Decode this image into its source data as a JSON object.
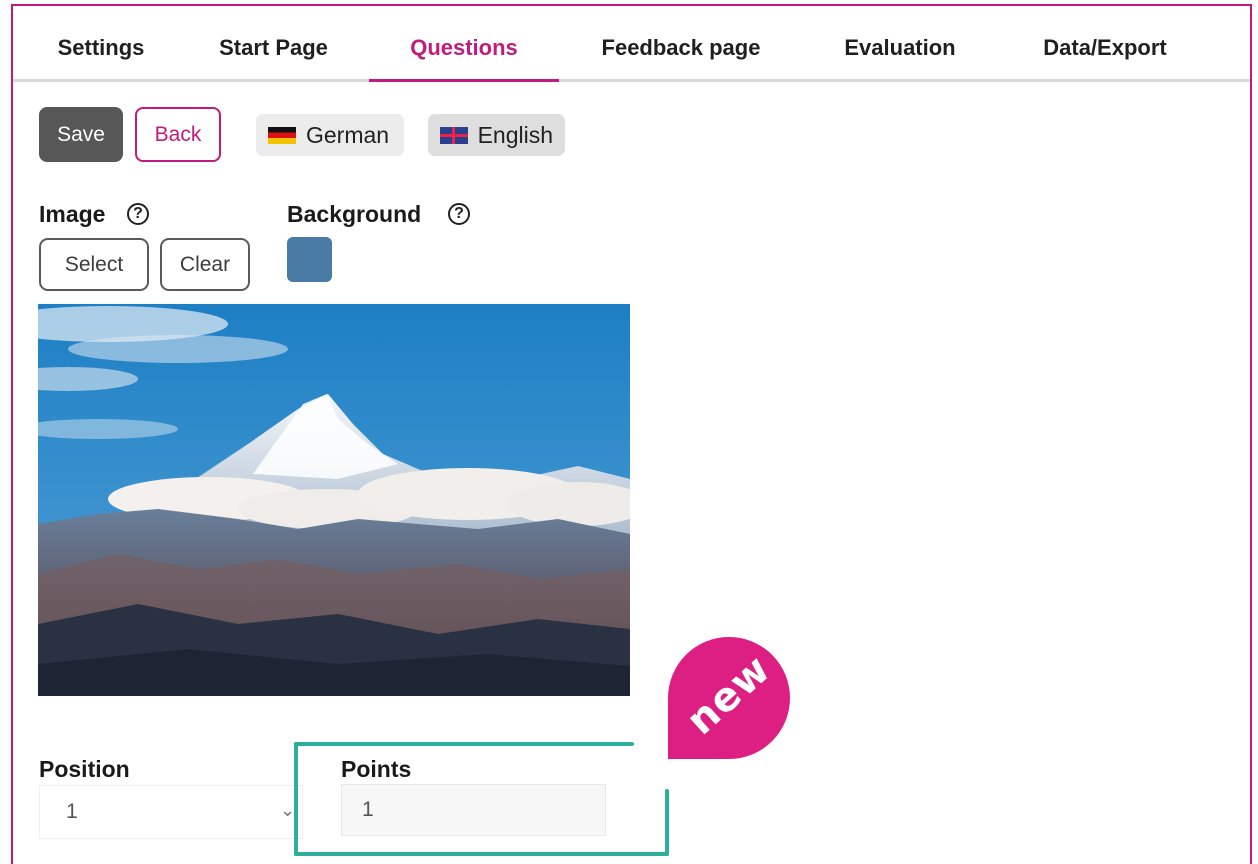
{
  "tabs": [
    {
      "label": "Settings",
      "active": false
    },
    {
      "label": "Start Page",
      "active": false
    },
    {
      "label": "Questions",
      "active": true
    },
    {
      "label": "Feedback page",
      "active": false
    },
    {
      "label": "Evaluation",
      "active": false
    },
    {
      "label": "Data/Export",
      "active": false
    }
  ],
  "toolbar": {
    "save_label": "Save",
    "back_label": "Back",
    "languages": [
      {
        "label": "German",
        "flag": "german-flag-icon"
      },
      {
        "label": "English",
        "flag": "english-flag-icon"
      }
    ]
  },
  "image_section": {
    "label": "Image",
    "help": "?",
    "select_label": "Select",
    "clear_label": "Clear"
  },
  "background_section": {
    "label": "Background",
    "help": "?",
    "color": "#4a7aa6"
  },
  "fields": {
    "position_label": "Position",
    "position_value": "1",
    "points_label": "Points",
    "points_value": "1"
  },
  "badge": {
    "label": "new",
    "color": "#dd1e82"
  },
  "colors": {
    "accent": "#c21b7c",
    "highlight": "#2eae9c",
    "save_bg": "#575757"
  }
}
